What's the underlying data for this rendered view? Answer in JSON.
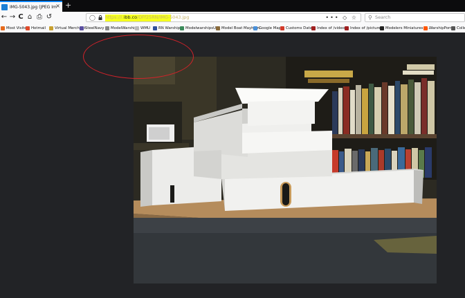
{
  "tab": {
    "title": "IMG-5043.jpg (JPEG Image, 1000 × ...",
    "close": "×",
    "new_tab": "+"
  },
  "nav": {
    "back": "←",
    "forward": "→",
    "reload": "C",
    "home": "⌂",
    "print": "⎙",
    "history": "↺"
  },
  "url": {
    "prefix": "https://i.",
    "domain": "ibb.co",
    "path": "/DFf25RN/IMG-5043.jpg",
    "actions": "••• ◇ ☆"
  },
  "search": {
    "placeholder": "Search"
  },
  "bookmarks": [
    {
      "label": "Most Visited",
      "color": "#e66a1c",
      "icon": "gear-icon"
    },
    {
      "label": "Hotmail",
      "color": "#e04a2b",
      "icon": "windows-icon"
    },
    {
      "label": "Virtual Merchant",
      "color": "#c8a030",
      "icon": "folder-icon"
    },
    {
      "label": "SteelNavy",
      "color": "#5a4ea0",
      "icon": "yahoo-icon"
    },
    {
      "label": "ModelWarships",
      "color": "#888888",
      "icon": "page-icon"
    },
    {
      "label": "WMU",
      "color": "#bbbbbb",
      "icon": "page-icon"
    },
    {
      "label": "RN Warships",
      "color": "#2f4f9a",
      "icon": "flag-icon"
    },
    {
      "label": "ModelwarshipsUK",
      "color": "#3a8a5a",
      "icon": "site-icon"
    },
    {
      "label": "Model Boat Mayhem",
      "color": "#8a6a3a",
      "icon": "site-icon"
    },
    {
      "label": "Google Maps",
      "color": "#4a90d9",
      "icon": "google-icon"
    },
    {
      "label": "Customs Data",
      "color": "#d23a2a",
      "icon": "site-icon"
    },
    {
      "label": "Index of /video",
      "color": "#a02020",
      "icon": "site-icon"
    },
    {
      "label": "Index of /pictures",
      "color": "#a02020",
      "icon": "site-icon"
    },
    {
      "label": "Modelers Miniatures a...",
      "color": "#222222",
      "icon": "site-icon"
    },
    {
      "label": "WarshipPorn",
      "color": "#ff5700",
      "icon": "reddit-icon"
    },
    {
      "label": "Colle",
      "color": "#555555",
      "icon": "site-icon"
    }
  ],
  "image": {
    "subject": "white styrene ship superstructure model on a workbench"
  },
  "colors": {
    "accent_tab": "#0a84ff",
    "highlight": "#f5ff1e",
    "annotation": "#d3232a",
    "viewer_bg": "#222326"
  }
}
